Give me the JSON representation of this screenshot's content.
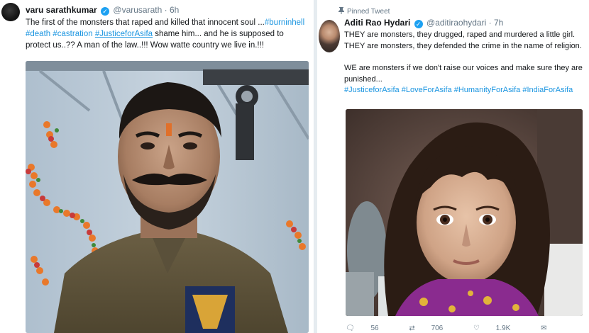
{
  "tweet_left": {
    "name": "varu sarathkumar",
    "handle": "@varusarath",
    "dot": "·",
    "time": "6h",
    "text_1": "The first of the monsters that raped and killed that innocent soul ...",
    "tag_burninhell": "#burninhell",
    "tag_death": "#death",
    "tag_castration": "#castration",
    "tag_justice": "#JusticeforAsifa",
    "text_2": "shame him... and he is supposed to protect us..?? A man of the law..!!! Wow watte country we live in.!!!"
  },
  "tweet_right": {
    "pinned_label": "Pinned Tweet",
    "name": "Aditi Rao Hydari",
    "handle": "@aditiraohydari",
    "dot": "·",
    "time": "7h",
    "text_1": "THEY are monsters, they drugged, raped and murdered a little girl. THEY are monsters, they defended the crime in the name of religion.",
    "text_2": "WE are monsters if we don't raise our voices and make sure they are punished...",
    "tags": [
      "#JusticeforAsifa",
      "#LoveForAsifa",
      "#HumanityForAsifa",
      "#IndiaForAsifa"
    ],
    "actions": {
      "replies": "56",
      "retweets": "706",
      "likes": "1.9K"
    }
  },
  "colors": {
    "link": "#1b95e0",
    "verified": "#1da1f2",
    "muted": "#657786"
  },
  "icons": [
    "verified-badge-icon",
    "pin-icon",
    "reply-icon",
    "retweet-icon",
    "like-icon",
    "message-icon"
  ]
}
